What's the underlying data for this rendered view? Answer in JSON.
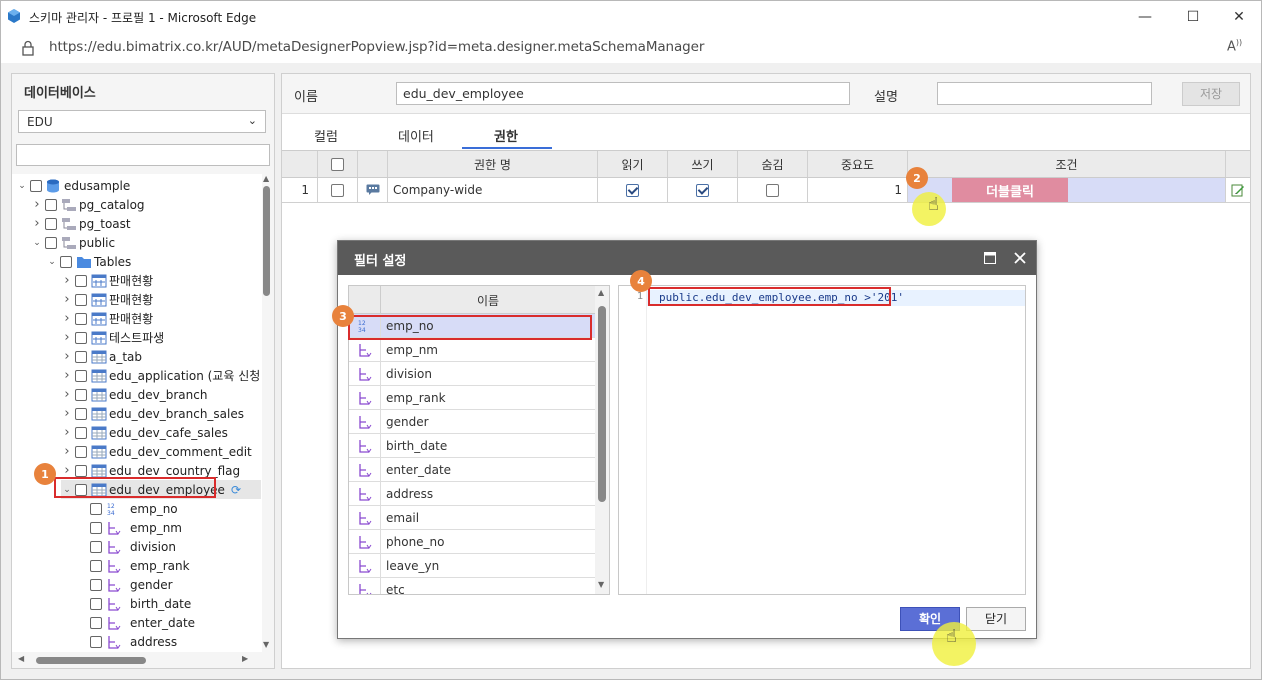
{
  "window": {
    "title": "스키마 관리자 - 프로필 1 - Microsoft Edge",
    "url": "https://edu.bimatrix.co.kr/AUD/metaDesignerPopview.jsp?id=meta.designer.metaSchemaManager",
    "controls": {
      "minimize": "—",
      "maximize": "☐",
      "close": "✕"
    },
    "reader_label": "Aᴬ"
  },
  "left_panel": {
    "header": "데이터베이스",
    "db_select": "EDU",
    "search_placeholder": "",
    "tree": [
      {
        "label": "edusample",
        "level": 0,
        "arrow": "open",
        "icon": "database-icon"
      },
      {
        "label": "pg_catalog",
        "level": 1,
        "arrow": "closed",
        "icon": "schema-icon"
      },
      {
        "label": "pg_toast",
        "level": 1,
        "arrow": "closed",
        "icon": "schema-icon"
      },
      {
        "label": "public",
        "level": 1,
        "arrow": "open",
        "icon": "schema-icon"
      },
      {
        "label": "Tables",
        "level": 2,
        "arrow": "open",
        "icon": "folder-icon"
      },
      {
        "label": "판매현황",
        "level": 3,
        "arrow": "closed",
        "icon": "view-icon"
      },
      {
        "label": "판매현황",
        "level": 3,
        "arrow": "closed",
        "icon": "view-icon"
      },
      {
        "label": "판매현황",
        "level": 3,
        "arrow": "closed",
        "icon": "view-icon"
      },
      {
        "label": "테스트파생",
        "level": 3,
        "arrow": "closed",
        "icon": "view-icon"
      },
      {
        "label": "a_tab",
        "level": 3,
        "arrow": "closed",
        "icon": "table-icon"
      },
      {
        "label": "edu_application (교육 신청",
        "level": 3,
        "arrow": "closed",
        "icon": "table-icon"
      },
      {
        "label": "edu_dev_branch",
        "level": 3,
        "arrow": "closed",
        "icon": "table-icon"
      },
      {
        "label": "edu_dev_branch_sales",
        "level": 3,
        "arrow": "closed",
        "icon": "table-icon"
      },
      {
        "label": "edu_dev_cafe_sales",
        "level": 3,
        "arrow": "closed",
        "icon": "table-icon"
      },
      {
        "label": "edu_dev_comment_edit",
        "level": 3,
        "arrow": "closed",
        "icon": "table-icon"
      },
      {
        "label": "edu_dev_country_flag",
        "level": 3,
        "arrow": "closed",
        "icon": "table-icon"
      },
      {
        "label": "edu_dev_employee",
        "level": 3,
        "arrow": "open",
        "icon": "table-icon",
        "selected": true
      },
      {
        "label": "emp_no",
        "level": 4,
        "arrow": "",
        "icon": "number-icon"
      },
      {
        "label": "emp_nm",
        "level": 4,
        "arrow": "",
        "icon": "string-icon"
      },
      {
        "label": "division",
        "level": 4,
        "arrow": "",
        "icon": "string-icon"
      },
      {
        "label": "emp_rank",
        "level": 4,
        "arrow": "",
        "icon": "string-icon"
      },
      {
        "label": "gender",
        "level": 4,
        "arrow": "",
        "icon": "string-icon"
      },
      {
        "label": "birth_date",
        "level": 4,
        "arrow": "",
        "icon": "string-icon"
      },
      {
        "label": "enter_date",
        "level": 4,
        "arrow": "",
        "icon": "string-icon"
      },
      {
        "label": "address",
        "level": 4,
        "arrow": "",
        "icon": "string-icon"
      }
    ]
  },
  "form": {
    "name_label": "이름",
    "name_value": "edu_dev_employee",
    "desc_label": "설명",
    "desc_value": "",
    "save_button": "저장"
  },
  "tabs": [
    {
      "label": "컬럼",
      "active": false
    },
    {
      "label": "데이터",
      "active": false
    },
    {
      "label": "권한",
      "active": true
    }
  ],
  "perm_grid": {
    "headers": [
      "권한 명",
      "읽기",
      "쓰기",
      "숨김",
      "중요도",
      "조건"
    ],
    "rows": [
      {
        "num": "1",
        "name": "Company-wide",
        "read": true,
        "write": true,
        "hide": false,
        "priority": "1",
        "condition": "더블클릭"
      }
    ]
  },
  "dialog": {
    "title": "필터 설정",
    "list_header": "이름",
    "columns": [
      {
        "name": "emp_no",
        "icon": "number-icon",
        "selected": true
      },
      {
        "name": "emp_nm",
        "icon": "string-icon"
      },
      {
        "name": "division",
        "icon": "string-icon"
      },
      {
        "name": "emp_rank",
        "icon": "string-icon"
      },
      {
        "name": "gender",
        "icon": "string-icon"
      },
      {
        "name": "birth_date",
        "icon": "string-icon"
      },
      {
        "name": "enter_date",
        "icon": "string-icon"
      },
      {
        "name": "address",
        "icon": "string-icon"
      },
      {
        "name": "email",
        "icon": "string-icon"
      },
      {
        "name": "phone_no",
        "icon": "string-icon"
      },
      {
        "name": "leave_yn",
        "icon": "string-icon"
      },
      {
        "name": "etc",
        "icon": "string-icon"
      }
    ],
    "code_line_no": "1",
    "code": "public.edu_dev_employee.emp_no >'201'",
    "ok_button": "확인",
    "close_button": "닫기"
  },
  "step_badges": [
    "1",
    "2",
    "3",
    "4"
  ],
  "colors": {
    "accent": "#3a6ed8",
    "badge": "#e8823c",
    "highlight_red": "#d92c2c",
    "dblclick_bg": "#e08ca0",
    "dialog_header": "#5a5a5a",
    "ok": "#5b6fd6"
  }
}
